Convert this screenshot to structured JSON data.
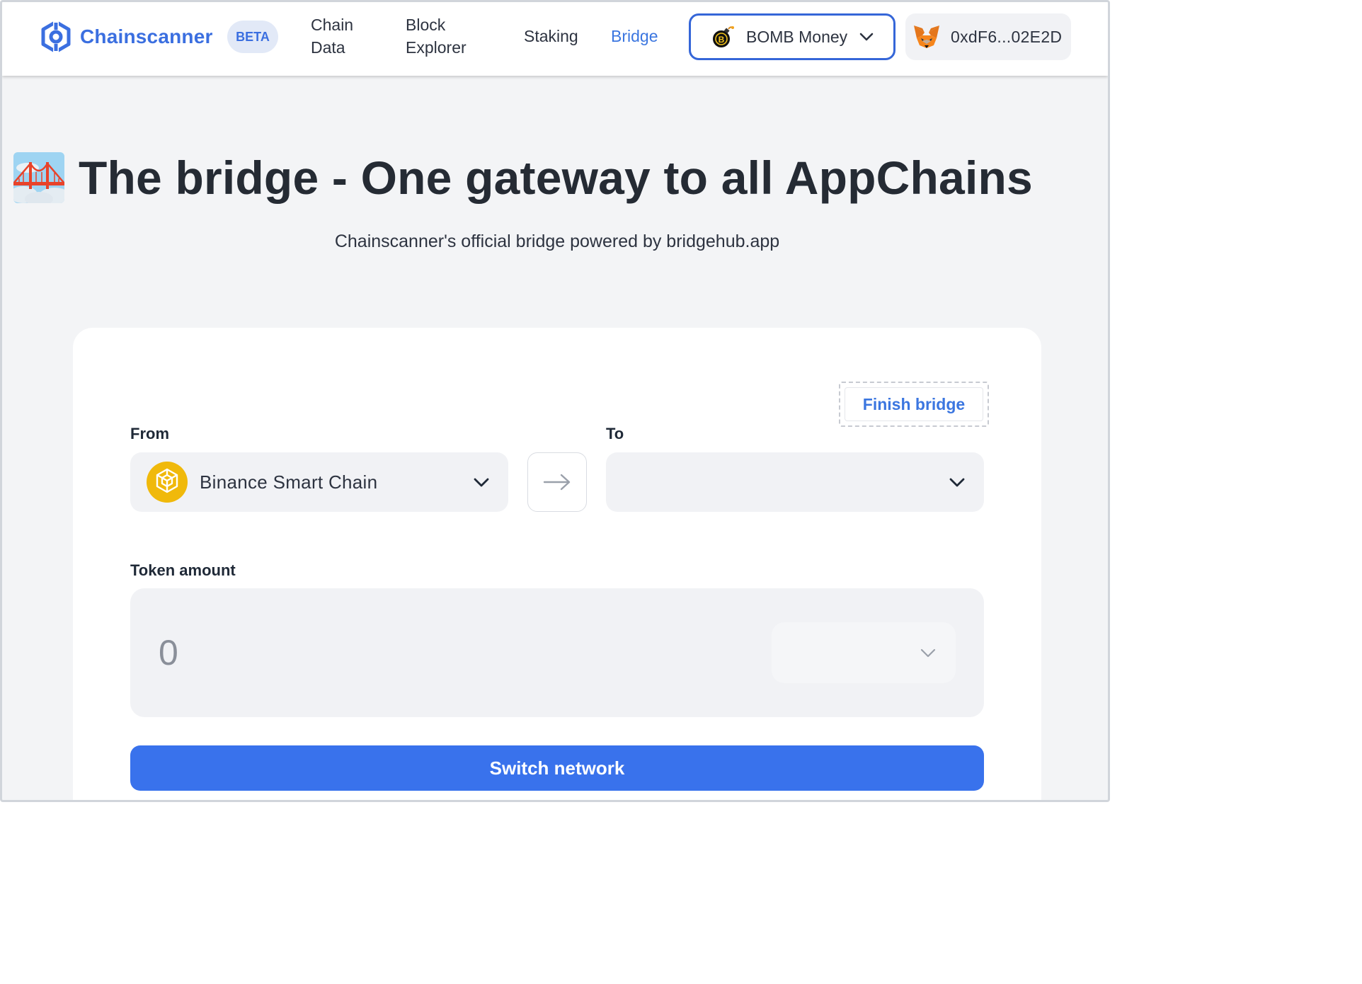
{
  "header": {
    "brand": "Chainscanner",
    "badge": "BETA",
    "nav": {
      "chain_data_line1": "Chain",
      "chain_data_line2": "Data",
      "block_explorer_line1": "Block",
      "block_explorer_line2": "Explorer",
      "staking": "Staking",
      "bridge": "Bridge"
    },
    "project_select": {
      "value": "BOMB Money",
      "icon": "bomb-icon"
    },
    "wallet": {
      "address": "0xdF6...02E2D",
      "icon": "metamask-fox-icon"
    },
    "active_color": "#3b76e0",
    "brand_color": "#3b6fe0"
  },
  "hero": {
    "title": "The bridge - One gateway to all AppChains",
    "subtitle": "Chainscanner's official bridge powered by bridgehub.app",
    "icon": "bridge-at-night-icon"
  },
  "bridge_form": {
    "finish_bridge": "Finish bridge",
    "from_label": "From",
    "from_value": "Binance Smart Chain",
    "from_icon": "bnb-icon",
    "to_label": "To",
    "to_value": "",
    "amount_label": "Token amount",
    "amount_placeholder": "0",
    "token_value": "",
    "submit": "Switch network",
    "submit_color": "#3972ec"
  }
}
